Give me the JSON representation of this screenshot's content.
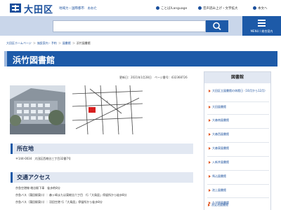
{
  "header": {
    "site_name": "大田区",
    "tagline": "地域力・国際都市　おおた",
    "links": [
      "ことば/Language",
      "音声読み上げ・文字拡大",
      "本文へ"
    ]
  },
  "menu": {
    "label": "MENU / 総合案内"
  },
  "breadcrumb": [
    "大田区ホームページ",
    "施設案内・予約",
    "図書館",
    "浜竹図書館"
  ],
  "page_title": "浜竹図書館",
  "updated": "更新日：2021年1月28日　ページ番号：432368726",
  "sections": {
    "location": {
      "heading": "所在地",
      "lines": [
        "〒144-0034　大田区西糀谷三丁目32番7号"
      ]
    },
    "access": {
      "heading": "交通アクセス",
      "lines": [
        "京急空港線 糀谷駅下車　徒歩約8分",
        "京急バス（蒲田駅東口）：森ヶ崎または東糀谷六丁目　行「大鳥居」停留所から徒歩8分",
        "京急バス（蒲田駅東口）：羽田空港 行「大鳥居」停留所から徒歩8分"
      ]
    }
  },
  "sidebar": {
    "heading": "図書館",
    "items": [
      "大田区立図書館の休館日（10月から12月）",
      "大田図書館",
      "大森南図書館",
      "大森西図書館",
      "大森東図書館",
      "入新井図書館",
      "馬込図書館",
      "池上図書館",
      "久が原図書館",
      "洗足池図書館"
    ]
  },
  "colors": {
    "brand": "#1d5aa8",
    "band": "#c9d6ea",
    "section_bg": "#e2e8f2",
    "bullet": "#e0531f"
  },
  "icons": [
    "city-emblem-icon",
    "search-icon",
    "menu-icon",
    "language-icon",
    "speaker-icon"
  ]
}
